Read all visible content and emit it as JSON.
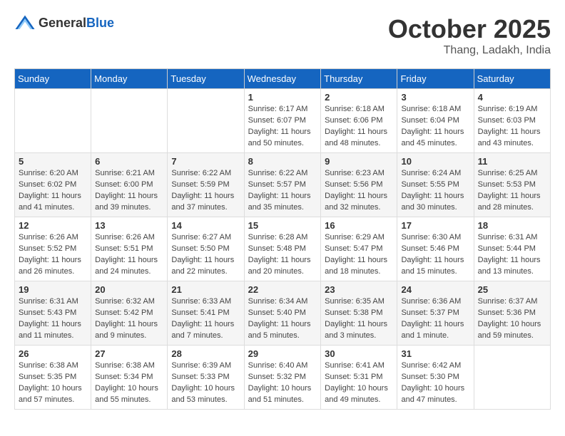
{
  "header": {
    "logo_general": "General",
    "logo_blue": "Blue",
    "month": "October 2025",
    "location": "Thang, Ladakh, India"
  },
  "weekdays": [
    "Sunday",
    "Monday",
    "Tuesday",
    "Wednesday",
    "Thursday",
    "Friday",
    "Saturday"
  ],
  "weeks": [
    [
      {
        "day": "",
        "info": ""
      },
      {
        "day": "",
        "info": ""
      },
      {
        "day": "",
        "info": ""
      },
      {
        "day": "1",
        "info": "Sunrise: 6:17 AM\nSunset: 6:07 PM\nDaylight: 11 hours\nand 50 minutes."
      },
      {
        "day": "2",
        "info": "Sunrise: 6:18 AM\nSunset: 6:06 PM\nDaylight: 11 hours\nand 48 minutes."
      },
      {
        "day": "3",
        "info": "Sunrise: 6:18 AM\nSunset: 6:04 PM\nDaylight: 11 hours\nand 45 minutes."
      },
      {
        "day": "4",
        "info": "Sunrise: 6:19 AM\nSunset: 6:03 PM\nDaylight: 11 hours\nand 43 minutes."
      }
    ],
    [
      {
        "day": "5",
        "info": "Sunrise: 6:20 AM\nSunset: 6:02 PM\nDaylight: 11 hours\nand 41 minutes."
      },
      {
        "day": "6",
        "info": "Sunrise: 6:21 AM\nSunset: 6:00 PM\nDaylight: 11 hours\nand 39 minutes."
      },
      {
        "day": "7",
        "info": "Sunrise: 6:22 AM\nSunset: 5:59 PM\nDaylight: 11 hours\nand 37 minutes."
      },
      {
        "day": "8",
        "info": "Sunrise: 6:22 AM\nSunset: 5:57 PM\nDaylight: 11 hours\nand 35 minutes."
      },
      {
        "day": "9",
        "info": "Sunrise: 6:23 AM\nSunset: 5:56 PM\nDaylight: 11 hours\nand 32 minutes."
      },
      {
        "day": "10",
        "info": "Sunrise: 6:24 AM\nSunset: 5:55 PM\nDaylight: 11 hours\nand 30 minutes."
      },
      {
        "day": "11",
        "info": "Sunrise: 6:25 AM\nSunset: 5:53 PM\nDaylight: 11 hours\nand 28 minutes."
      }
    ],
    [
      {
        "day": "12",
        "info": "Sunrise: 6:26 AM\nSunset: 5:52 PM\nDaylight: 11 hours\nand 26 minutes."
      },
      {
        "day": "13",
        "info": "Sunrise: 6:26 AM\nSunset: 5:51 PM\nDaylight: 11 hours\nand 24 minutes."
      },
      {
        "day": "14",
        "info": "Sunrise: 6:27 AM\nSunset: 5:50 PM\nDaylight: 11 hours\nand 22 minutes."
      },
      {
        "day": "15",
        "info": "Sunrise: 6:28 AM\nSunset: 5:48 PM\nDaylight: 11 hours\nand 20 minutes."
      },
      {
        "day": "16",
        "info": "Sunrise: 6:29 AM\nSunset: 5:47 PM\nDaylight: 11 hours\nand 18 minutes."
      },
      {
        "day": "17",
        "info": "Sunrise: 6:30 AM\nSunset: 5:46 PM\nDaylight: 11 hours\nand 15 minutes."
      },
      {
        "day": "18",
        "info": "Sunrise: 6:31 AM\nSunset: 5:44 PM\nDaylight: 11 hours\nand 13 minutes."
      }
    ],
    [
      {
        "day": "19",
        "info": "Sunrise: 6:31 AM\nSunset: 5:43 PM\nDaylight: 11 hours\nand 11 minutes."
      },
      {
        "day": "20",
        "info": "Sunrise: 6:32 AM\nSunset: 5:42 PM\nDaylight: 11 hours\nand 9 minutes."
      },
      {
        "day": "21",
        "info": "Sunrise: 6:33 AM\nSunset: 5:41 PM\nDaylight: 11 hours\nand 7 minutes."
      },
      {
        "day": "22",
        "info": "Sunrise: 6:34 AM\nSunset: 5:40 PM\nDaylight: 11 hours\nand 5 minutes."
      },
      {
        "day": "23",
        "info": "Sunrise: 6:35 AM\nSunset: 5:38 PM\nDaylight: 11 hours\nand 3 minutes."
      },
      {
        "day": "24",
        "info": "Sunrise: 6:36 AM\nSunset: 5:37 PM\nDaylight: 11 hours\nand 1 minute."
      },
      {
        "day": "25",
        "info": "Sunrise: 6:37 AM\nSunset: 5:36 PM\nDaylight: 10 hours\nand 59 minutes."
      }
    ],
    [
      {
        "day": "26",
        "info": "Sunrise: 6:38 AM\nSunset: 5:35 PM\nDaylight: 10 hours\nand 57 minutes."
      },
      {
        "day": "27",
        "info": "Sunrise: 6:38 AM\nSunset: 5:34 PM\nDaylight: 10 hours\nand 55 minutes."
      },
      {
        "day": "28",
        "info": "Sunrise: 6:39 AM\nSunset: 5:33 PM\nDaylight: 10 hours\nand 53 minutes."
      },
      {
        "day": "29",
        "info": "Sunrise: 6:40 AM\nSunset: 5:32 PM\nDaylight: 10 hours\nand 51 minutes."
      },
      {
        "day": "30",
        "info": "Sunrise: 6:41 AM\nSunset: 5:31 PM\nDaylight: 10 hours\nand 49 minutes."
      },
      {
        "day": "31",
        "info": "Sunrise: 6:42 AM\nSunset: 5:30 PM\nDaylight: 10 hours\nand 47 minutes."
      },
      {
        "day": "",
        "info": ""
      }
    ]
  ]
}
